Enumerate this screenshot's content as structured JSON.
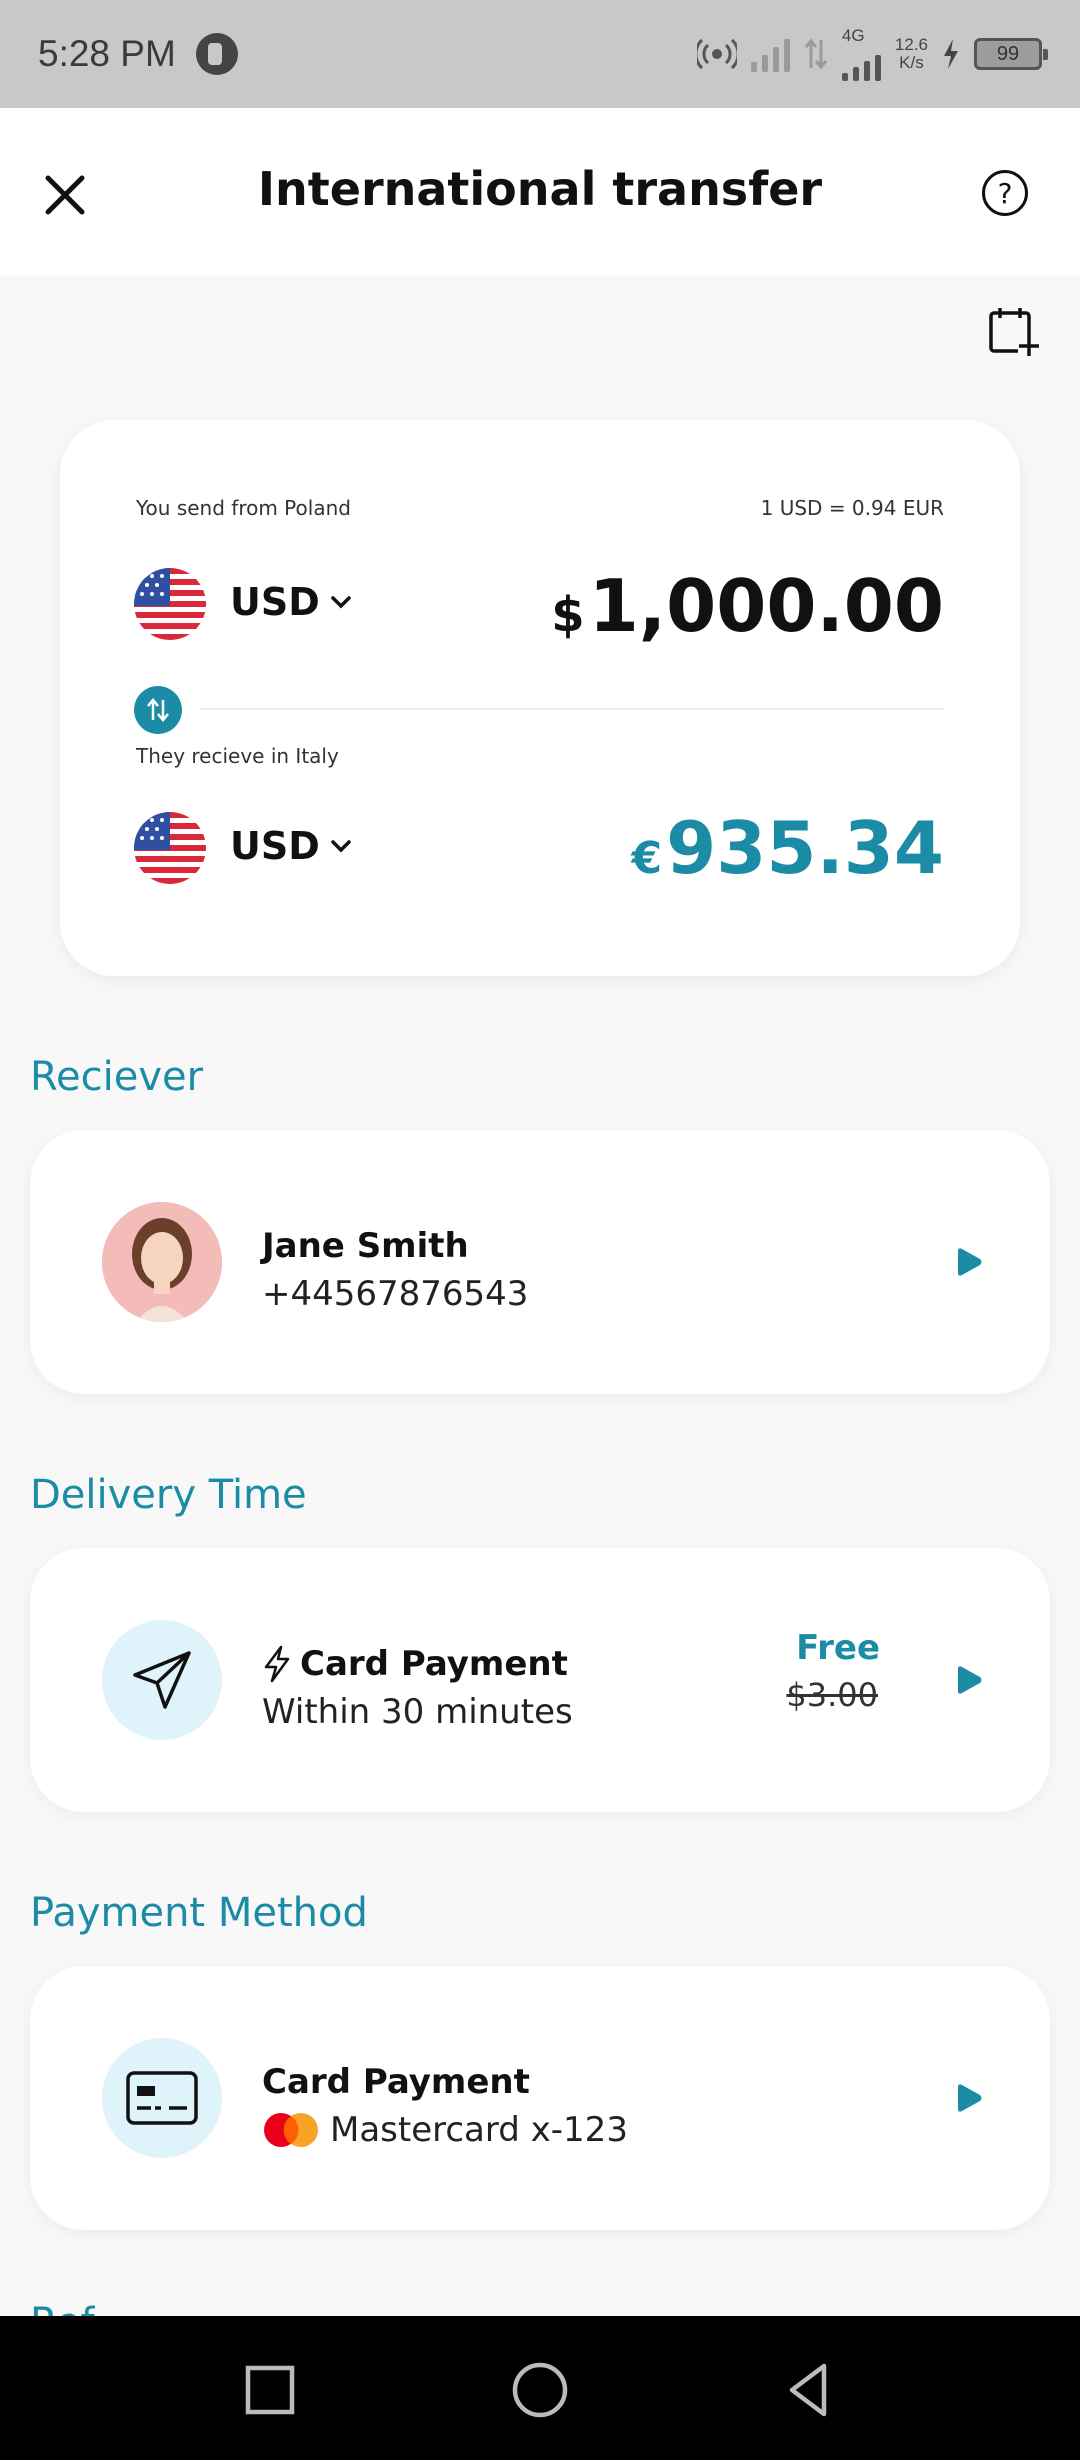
{
  "status": {
    "time": "5:28 PM",
    "network_type": "4G",
    "speed_value": "12.6",
    "speed_unit": "K/s",
    "battery": "99"
  },
  "header": {
    "title": "International transfer",
    "help_symbol": "?"
  },
  "converter": {
    "send_label": "You send from Poland",
    "rate_label": "1 USD = 0.94 EUR",
    "send_currency": "USD",
    "send_symbol": "$",
    "send_amount": "1,000.00",
    "receive_label": "They recieve in Italy",
    "receive_currency": "USD",
    "receive_symbol": "€",
    "receive_amount": "935.34"
  },
  "receiver": {
    "section_title": "Reciever",
    "name": "Jane Smith",
    "phone": "+44567876543"
  },
  "delivery": {
    "section_title": "Delivery Time",
    "title": "Card Payment",
    "subtitle": "Within 30 minutes",
    "price_free": "Free",
    "price_old": "$3.00"
  },
  "payment": {
    "section_title": "Payment Method",
    "title": "Card Payment",
    "card_label": "Mastercard x-123"
  },
  "next_section_peek": "Ref",
  "colors": {
    "accent": "#1b8ba6",
    "icon_bg": "#dff3fa",
    "mastercard_red": "#eb001b",
    "mastercard_orange": "#f79e1b"
  },
  "icons": {
    "close": "close-icon",
    "help": "help-icon",
    "calendar_add": "calendar-add-icon",
    "swap": "swap-icon",
    "send": "send-icon",
    "lightning": "lightning-icon",
    "card": "card-icon",
    "chevron": "chevron-right-icon"
  }
}
